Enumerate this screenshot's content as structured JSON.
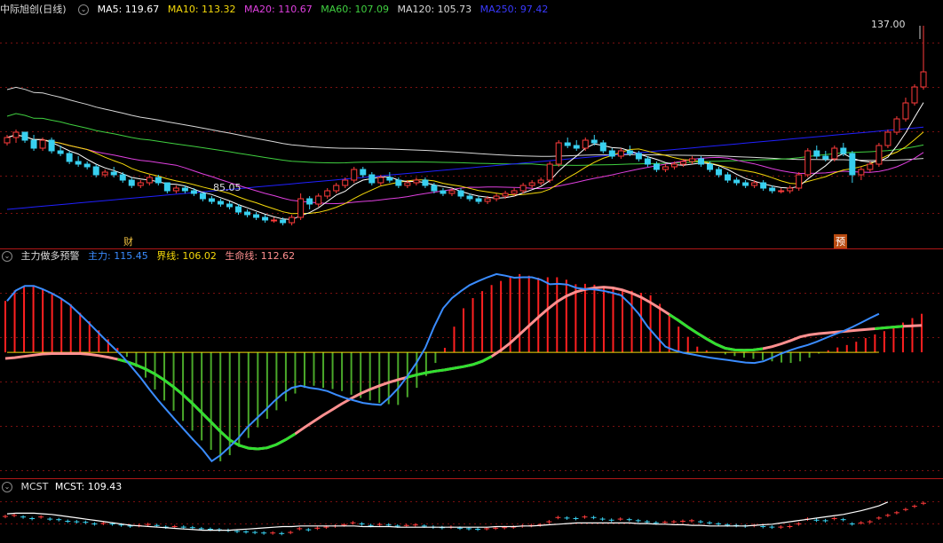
{
  "colors": {
    "up": "#ff3b3b",
    "down": "#38d0f0",
    "ma5": "#ffffff",
    "ma10": "#f5d90a",
    "ma20": "#e040e0",
    "ma60": "#40d040",
    "ma120": "#d8d8d8",
    "ma250": "#2020ff",
    "zhuli": "#3a8cff",
    "jiexian": "#f5d90a",
    "shengming": "#ff9090",
    "grid": "#7a1010",
    "bar_up": "#ff2020",
    "bar_down": "#4aa82a",
    "mcst": "#ffffff"
  },
  "price_panel": {
    "title": "中际旭创(日线)",
    "ma5_label": "MA5: 119.67",
    "ma10_label": "MA10: 113.32",
    "ma20_label": "MA20: 110.67",
    "ma60_label": "MA60: 107.09",
    "ma120_label": "MA120: 105.73",
    "ma250_label": "MA250: 97.42",
    "high_label": "137.00",
    "low_label": "85.05",
    "event_cai": "财",
    "event_yu": "预"
  },
  "indicator_panel": {
    "title": "主力做多预警",
    "zhuli_label": "主力: 115.45",
    "jiexian_label": "界线: 106.02",
    "shengming_label": "生命线: 112.62"
  },
  "mcst_panel": {
    "title": "MCST",
    "value_label": "MCST: 109.43"
  },
  "chart_data": [
    {
      "type": "candlestick",
      "title": "中际旭创(日线)",
      "candles": [
        [
          93,
          96,
          92,
          95
        ],
        [
          95,
          98,
          93,
          97
        ],
        [
          97,
          97,
          93,
          94
        ],
        [
          94,
          96,
          90,
          91
        ],
        [
          91,
          95,
          90,
          94
        ],
        [
          94,
          95,
          89,
          90
        ],
        [
          90,
          92,
          88,
          89
        ],
        [
          89,
          90,
          85,
          86
        ],
        [
          86,
          88,
          84,
          85
        ],
        [
          85,
          86,
          83,
          84
        ],
        [
          84,
          85,
          80,
          81
        ],
        [
          81,
          83,
          80,
          82
        ],
        [
          82,
          84,
          80,
          81
        ],
        [
          81,
          82,
          78,
          79
        ],
        [
          79,
          80,
          76,
          77
        ],
        [
          77,
          79,
          76,
          78
        ],
        [
          78,
          81,
          77,
          80
        ],
        [
          80,
          81,
          77,
          78
        ],
        [
          78,
          78,
          74,
          75
        ],
        [
          75,
          77,
          74,
          76
        ],
        [
          76,
          77,
          74,
          75
        ],
        [
          75,
          76,
          73,
          74
        ],
        [
          74,
          74,
          71,
          72
        ],
        [
          72,
          73,
          70,
          71
        ],
        [
          71,
          72,
          69,
          70
        ],
        [
          70,
          71,
          68,
          69
        ],
        [
          69,
          70,
          66,
          67
        ],
        [
          67,
          68,
          65,
          66
        ],
        [
          66,
          67,
          64,
          65
        ],
        [
          65,
          66,
          63,
          64
        ],
        [
          64,
          65,
          63,
          64
        ],
        [
          64,
          65,
          62,
          63
        ],
        [
          63,
          66,
          62,
          65
        ],
        [
          65,
          74,
          64,
          72
        ],
        [
          72,
          73,
          68,
          70
        ],
        [
          70,
          74,
          69,
          73
        ],
        [
          73,
          76,
          72,
          75
        ],
        [
          75,
          78,
          74,
          77
        ],
        [
          77,
          80,
          76,
          79
        ],
        [
          79,
          84,
          78,
          83
        ],
        [
          83,
          84,
          80,
          81
        ],
        [
          81,
          82,
          77,
          78
        ],
        [
          78,
          81,
          77,
          80
        ],
        [
          80,
          82,
          78,
          79
        ],
        [
          79,
          80,
          76,
          77
        ],
        [
          77,
          79,
          76,
          78
        ],
        [
          78,
          80,
          77,
          79
        ],
        [
          79,
          80,
          76,
          77
        ],
        [
          77,
          78,
          74,
          75
        ],
        [
          75,
          76,
          73,
          74
        ],
        [
          74,
          76,
          73,
          75
        ],
        [
          75,
          76,
          72,
          73
        ],
        [
          73,
          74,
          71,
          72
        ],
        [
          72,
          73,
          70,
          71
        ],
        [
          71,
          73,
          70,
          72
        ],
        [
          72,
          74,
          71,
          73
        ],
        [
          73,
          75,
          72,
          74
        ],
        [
          74,
          76,
          73,
          75
        ],
        [
          75,
          78,
          74,
          77
        ],
        [
          77,
          79,
          76,
          78
        ],
        [
          78,
          80,
          77,
          79
        ],
        [
          79,
          86,
          78,
          85
        ],
        [
          85,
          94,
          84,
          93
        ],
        [
          93,
          95,
          91,
          92
        ],
        [
          92,
          94,
          90,
          91
        ],
        [
          91,
          95,
          90,
          94
        ],
        [
          94,
          96,
          92,
          93
        ],
        [
          93,
          94,
          89,
          90
        ],
        [
          90,
          91,
          87,
          88
        ],
        [
          88,
          91,
          87,
          90
        ],
        [
          90,
          92,
          88,
          89
        ],
        [
          89,
          90,
          86,
          87
        ],
        [
          87,
          88,
          84,
          85
        ],
        [
          85,
          86,
          82,
          83
        ],
        [
          83,
          85,
          82,
          84
        ],
        [
          84,
          86,
          83,
          85
        ],
        [
          85,
          87,
          84,
          86
        ],
        [
          86,
          88,
          85,
          87
        ],
        [
          87,
          88,
          84,
          85
        ],
        [
          85,
          86,
          82,
          83
        ],
        [
          83,
          84,
          80,
          81
        ],
        [
          81,
          82,
          78,
          79
        ],
        [
          79,
          80,
          77,
          78
        ],
        [
          78,
          79,
          76,
          77
        ],
        [
          77,
          79,
          76,
          78
        ],
        [
          78,
          79,
          75,
          76
        ],
        [
          76,
          77,
          74,
          75
        ],
        [
          75,
          76,
          74,
          75
        ],
        [
          75,
          77,
          74,
          76
        ],
        [
          76,
          82,
          75,
          81
        ],
        [
          81,
          91,
          80,
          90
        ],
        [
          90,
          92,
          87,
          88
        ],
        [
          88,
          90,
          86,
          87
        ],
        [
          87,
          92,
          86,
          91
        ],
        [
          91,
          93,
          88,
          89
        ],
        [
          89,
          90,
          78,
          81
        ],
        [
          81,
          84,
          79,
          83
        ],
        [
          83,
          86,
          82,
          85
        ],
        [
          85,
          93,
          84,
          92
        ],
        [
          92,
          98,
          91,
          97
        ],
        [
          97,
          103,
          96,
          102
        ],
        [
          102,
          110,
          101,
          108
        ],
        [
          108,
          115,
          107,
          114
        ],
        [
          114,
          137,
          113,
          119.67
        ]
      ]
    },
    {
      "type": "line",
      "title": "主力做多预警",
      "series": [
        {
          "name": "主力",
          "values": [
            118.6,
            121.2,
            122.3,
            122.3,
            121.5,
            120.5,
            119.3,
            117.8,
            115.7,
            113.6,
            111.4,
            109.2,
            107.1,
            104.9,
            102.4,
            99.8,
            96.9,
            94.2,
            91.7,
            89.2,
            86.8,
            84.4,
            82.1,
            79.3,
            80.8,
            82.8,
            85.0,
            87.6,
            89.7,
            91.8,
            94.0,
            95.9,
            97.3,
            97.8,
            97.3,
            97.0,
            96.5,
            95.6,
            94.8,
            94.2,
            93.6,
            93.3,
            93.1,
            95.0,
            97.3,
            100.2,
            103.4,
            107.1,
            112.3,
            116.8,
            119.3,
            121.0,
            122.5,
            123.5,
            124.4,
            125.2,
            124.8,
            124.3,
            124.4,
            124.4,
            123.8,
            122.7,
            122.8,
            122.6,
            121.8,
            121.5,
            121.4,
            121.1,
            120.6,
            120.0,
            117.9,
            115.4,
            112.3,
            109.8,
            107.4,
            106.5,
            105.9,
            105.5,
            105.1,
            104.7,
            104.4,
            104.1,
            103.8,
            103.5,
            103.4,
            103.8,
            104.7,
            105.7,
            106.5,
            107.2,
            107.8,
            108.6,
            109.5,
            110.4,
            111.2,
            112.2,
            113.3,
            114.4,
            115.45
          ]
        },
        {
          "name": "界线",
          "values": [
            106.0,
            106.0,
            106.0,
            106.0,
            106.0,
            106.0,
            106.0,
            106.0,
            106.0,
            106.0,
            106.0,
            106.0,
            106.0,
            106.0,
            106.0,
            106.0,
            106.0,
            106.0,
            106.0,
            106.0,
            106.0,
            106.0,
            106.0,
            106.0,
            106.0,
            106.0,
            106.0,
            106.0,
            106.0,
            106.0,
            106.0,
            106.0,
            106.0,
            106.0,
            106.0,
            106.0,
            106.0,
            106.0,
            106.0,
            106.0,
            106.0,
            106.0,
            106.0,
            106.0,
            106.0,
            106.0,
            106.0,
            106.0,
            106.0,
            106.0,
            106.0,
            106.0,
            106.0,
            106.0,
            106.0,
            106.0,
            106.0,
            106.0,
            106.0,
            106.0,
            106.0,
            106.0,
            106.0,
            106.0,
            106.0,
            106.0,
            106.0,
            106.0,
            106.0,
            106.0,
            106.0,
            106.0,
            106.0,
            106.0,
            106.0,
            106.0,
            106.0,
            106.0,
            106.0,
            106.0,
            106.0,
            106.0,
            106.0,
            106.0,
            106.0,
            106.0,
            106.0,
            106.0,
            106.0,
            106.0,
            106.0,
            106.0,
            106.0,
            106.0,
            106.0,
            106.0,
            106.0,
            106.0,
            106.02
          ]
        },
        {
          "name": "生命线",
          "values": [
            104.5,
            104.7,
            105.0,
            105.3,
            105.6,
            105.7,
            105.7,
            105.7,
            105.7,
            105.5,
            105.2,
            104.8,
            104.3,
            103.7,
            102.9,
            101.9,
            100.7,
            99.2,
            97.5,
            95.6,
            93.5,
            91.2,
            88.9,
            86.6,
            84.5,
            83.2,
            82.5,
            82.3,
            82.6,
            83.4,
            84.6,
            86.0,
            87.6,
            89.1,
            90.6,
            92.0,
            93.4,
            94.7,
            95.9,
            96.9,
            97.8,
            98.6,
            99.3,
            99.9,
            100.5,
            101.0,
            101.4,
            101.7,
            102.1,
            102.5,
            103.0,
            103.8,
            105.0,
            106.5,
            108.3,
            110.4,
            112.5,
            114.6,
            116.6,
            118.4,
            119.8,
            120.8,
            121.4,
            121.8,
            122.0,
            121.8,
            121.3,
            120.5,
            119.5,
            118.2,
            116.8,
            115.3,
            113.8,
            112.2,
            110.7,
            109.3,
            108.0,
            107.0,
            106.6,
            106.5,
            106.6,
            106.9,
            107.4,
            108.1,
            108.9,
            109.8,
            110.3,
            110.6,
            110.8,
            111.0,
            111.2,
            111.4,
            111.6,
            111.8,
            112.0,
            112.2,
            112.4,
            112.5,
            112.62
          ]
        }
      ]
    },
    {
      "type": "line",
      "title": "MCST",
      "series": [
        {
          "name": "MCST",
          "values": [
            107.5,
            107.6,
            107.6,
            107.6,
            107.5,
            107.4,
            107.2,
            107.0,
            106.8,
            106.6,
            106.4,
            106.2,
            106.0,
            105.8,
            105.6,
            105.5,
            105.4,
            105.3,
            105.2,
            105.1,
            105.0,
            104.9,
            104.8,
            104.8,
            104.8,
            104.8,
            104.9,
            105.0,
            105.1,
            105.2,
            105.3,
            105.4,
            105.4,
            105.5,
            105.5,
            105.5,
            105.5,
            105.5,
            105.5,
            105.5,
            105.4,
            105.4,
            105.4,
            105.4,
            105.3,
            105.3,
            105.3,
            105.3,
            105.3,
            105.3,
            105.3,
            105.3,
            105.3,
            105.3,
            105.3,
            105.4,
            105.4,
            105.4,
            105.5,
            105.5,
            105.6,
            105.7,
            105.8,
            105.9,
            106.0,
            106.0,
            106.0,
            106.0,
            106.0,
            106.0,
            106.0,
            105.9,
            105.9,
            105.8,
            105.8,
            105.7,
            105.7,
            105.6,
            105.6,
            105.5,
            105.5,
            105.5,
            105.5,
            105.5,
            105.6,
            105.7,
            105.8,
            106.0,
            106.2,
            106.4,
            106.6,
            106.8,
            107.0,
            107.2,
            107.4,
            107.7,
            108.0,
            108.4,
            108.8,
            109.43
          ]
        }
      ]
    }
  ]
}
